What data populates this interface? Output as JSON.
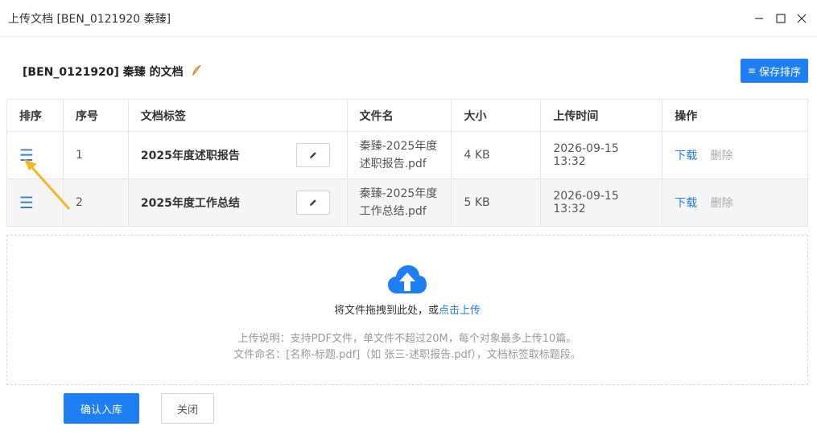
{
  "window": {
    "title": "上传文档 [BEN_0121920 秦臻]"
  },
  "header": {
    "doc_title": "[BEN_0121920] 秦臻 的文档",
    "save_button": "保存排序",
    "save_icon": "≡"
  },
  "table": {
    "columns": [
      "排序",
      "序号",
      "文档标签",
      "文件名",
      "大小",
      "上传时间",
      "操作"
    ],
    "rows": [
      {
        "index": "1",
        "tag": "2025年度述职报告",
        "filename_line1": "秦臻-2025年度",
        "filename_line2": "述职报告.pdf",
        "size": "4 KB",
        "uploaded": "2026-09-15 13:32",
        "download": "下载",
        "delete": "删除"
      },
      {
        "index": "2",
        "tag": "2025年度工作总结",
        "filename_line1": "秦臻-2025年度",
        "filename_line2": "工作总结.pdf",
        "size": "5 KB",
        "uploaded": "2026-09-15 13:32",
        "download": "下载",
        "delete": "删除"
      }
    ]
  },
  "upload": {
    "prompt_prefix": "将文件拖拽到此处，或",
    "prompt_link": "点击上传",
    "note_line1": "上传说明：支持PDF文件，单文件不超过20M，每个对象最多上传10篇。",
    "note_line2": "文件命名：[名称-标题.pdf]（如 张三-述职报告.pdf），文档标签取标题段。"
  },
  "footer": {
    "confirm": "确认入库",
    "close": "关闭"
  },
  "colors": {
    "accent": "#1e7ef3",
    "drag_handle": "#3a7ed8",
    "annotation_arrow": "#f5b822"
  }
}
